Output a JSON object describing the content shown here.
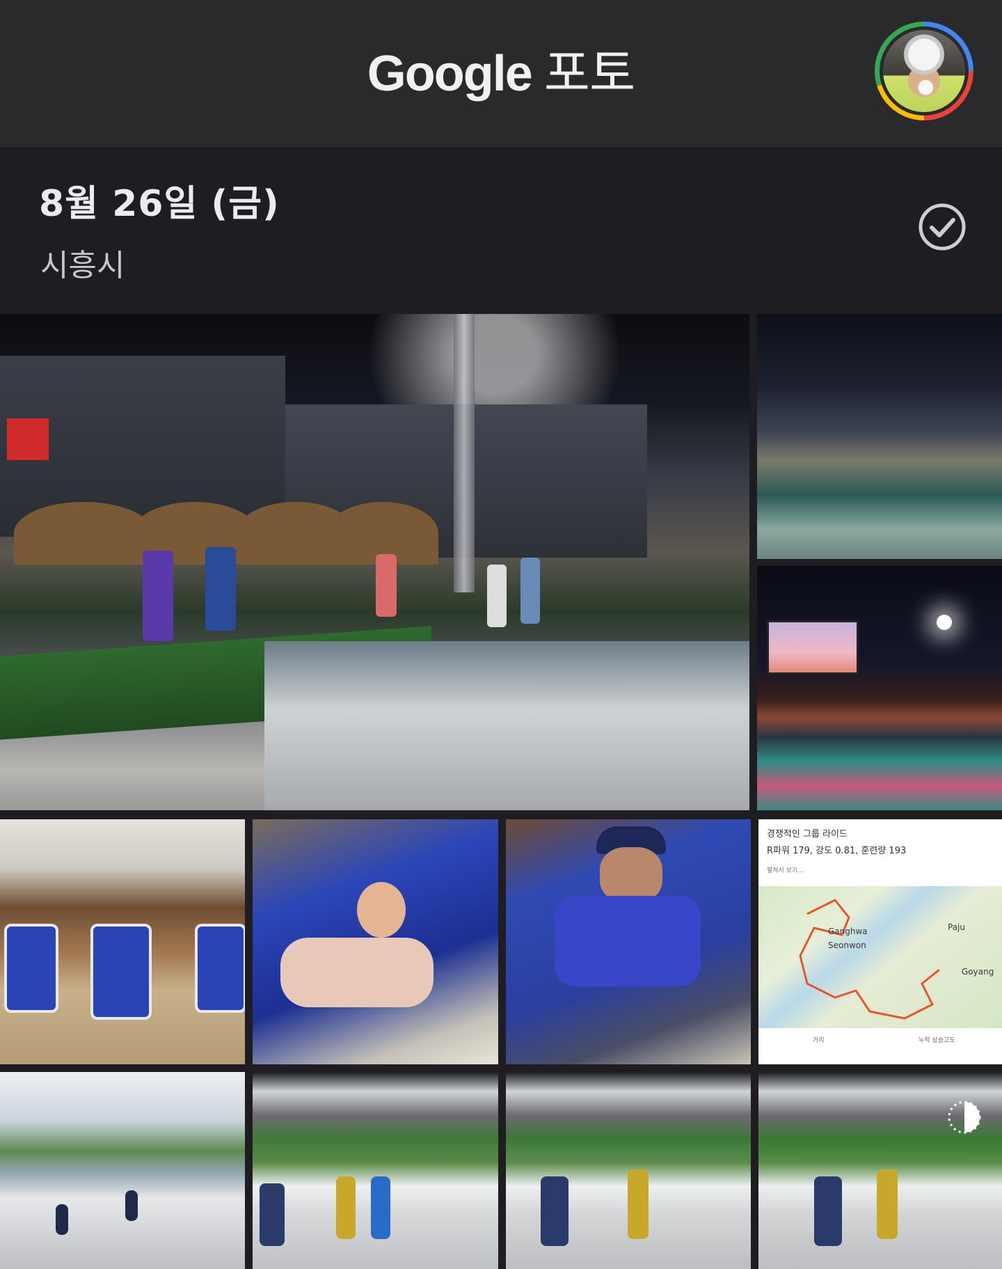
{
  "app": {
    "brand_google": "Google",
    "brand_product": "포토"
  },
  "section": {
    "date": "8월 26일 (금)",
    "place": "시흥시"
  },
  "ride_card": {
    "title": "경쟁적인 그룹 라이드",
    "stats": "R파워 179, 강도 0.81, 훈련량 193",
    "more": "펼쳐서 보기...",
    "map_labels": [
      "Ganghwa",
      "Seonwon",
      "Paju",
      "Goyang"
    ],
    "footer_left": "거리",
    "footer_right": "누적 상승고도"
  },
  "colors": {
    "appbar": "#2a2a2d",
    "background": "#1f1d22",
    "route": "#e4572e"
  },
  "icons": {
    "select": "check-circle-icon",
    "motion": "motion-photo-icon"
  }
}
